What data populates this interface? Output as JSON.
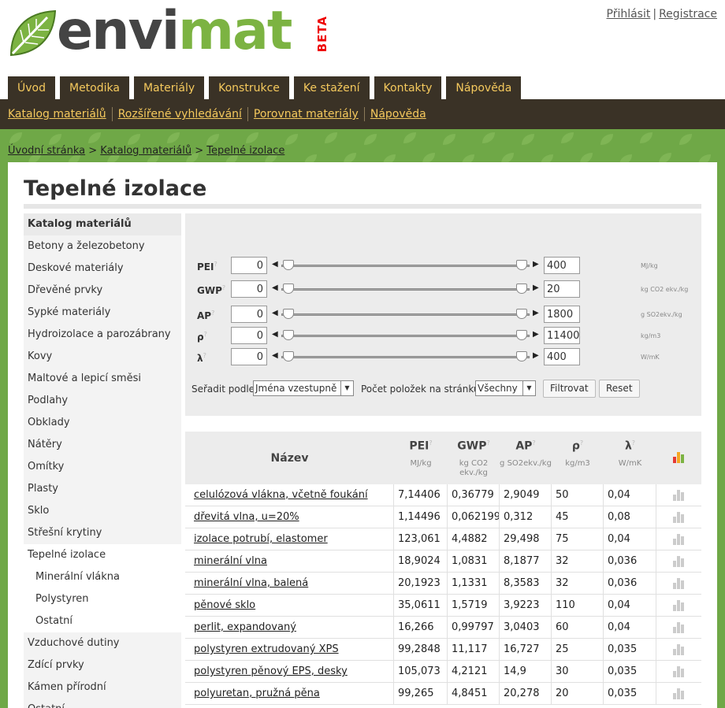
{
  "header": {
    "logo_text_a": "envi",
    "logo_text_b": "mat",
    "logo_badge": "BETA",
    "login": "Přihlásit",
    "separator": "|",
    "register": "Registrace"
  },
  "main_nav": [
    "Úvod",
    "Metodika",
    "Materiály",
    "Konstrukce",
    "Ke stažení",
    "Kontakty",
    "Nápověda"
  ],
  "sub_nav": [
    "Katalog materiálů",
    "Rozšířené vyhledávání",
    "Porovnat materiály",
    "Nápověda"
  ],
  "breadcrumb": {
    "home": "Úvodní stránka",
    "sep": ">",
    "catalog": "Katalog materiálů",
    "current": "Tepelné izolace"
  },
  "page_title": "Tepelné izolace",
  "sidebar": [
    {
      "label": "Katalog materiálů",
      "kind": "head"
    },
    {
      "label": "Betony a železobetony",
      "kind": "item"
    },
    {
      "label": "Deskové materiály",
      "kind": "item"
    },
    {
      "label": "Dřevěné prvky",
      "kind": "item"
    },
    {
      "label": "Sypké materiály",
      "kind": "item"
    },
    {
      "label": "Hydroizolace a parozábrany",
      "kind": "item"
    },
    {
      "label": "Kovy",
      "kind": "item"
    },
    {
      "label": "Maltové a lepicí směsi",
      "kind": "item"
    },
    {
      "label": "Podlahy",
      "kind": "item"
    },
    {
      "label": "Obklady",
      "kind": "item"
    },
    {
      "label": "Nátěry",
      "kind": "item"
    },
    {
      "label": "Omítky",
      "kind": "item"
    },
    {
      "label": "Plasty",
      "kind": "item"
    },
    {
      "label": "Sklo",
      "kind": "item"
    },
    {
      "label": "Střešní krytiny",
      "kind": "item"
    },
    {
      "label": "Tepelné izolace",
      "kind": "active"
    },
    {
      "label": "Minerální vlákna",
      "kind": "sub"
    },
    {
      "label": "Polystyren",
      "kind": "sub"
    },
    {
      "label": "Ostatní",
      "kind": "sub"
    },
    {
      "label": "Vzduchové dutiny",
      "kind": "item"
    },
    {
      "label": "Zdící prvky",
      "kind": "item"
    },
    {
      "label": "Kámen přírodní",
      "kind": "item"
    },
    {
      "label": "Ostatní",
      "kind": "item"
    }
  ],
  "filters": [
    {
      "label": "PEI",
      "sup": "?",
      "min": "0",
      "max": "400",
      "unit": "MJ/kg"
    },
    {
      "label": "GWP",
      "sup": "?",
      "min": "0",
      "max": "20",
      "unit": "kg CO2 ekv./kg"
    },
    {
      "label": "AP",
      "sup": "?",
      "min": "0",
      "max": "1800",
      "unit": "g SO2ekv./kg"
    },
    {
      "label": "ρ",
      "sup": "?",
      "min": "0",
      "max": "11400",
      "unit": "kg/m3"
    },
    {
      "label": "λ",
      "sup": "?",
      "min": "0",
      "max": "400",
      "unit": "W/mK"
    }
  ],
  "sort": {
    "label": "Seřadit podle:",
    "value": "Jména vzestupně",
    "per_page_label": "Počet položek na stránku:",
    "per_page_value": "Všechny",
    "filter_button": "Filtrovat",
    "reset_button": "Reset"
  },
  "table": {
    "headers": [
      {
        "name": "Název",
        "unit": ""
      },
      {
        "name": "PEI",
        "sup": "?",
        "unit": "MJ/kg"
      },
      {
        "name": "GWP",
        "sup": "?",
        "unit": "kg CO2 ekv./kg"
      },
      {
        "name": "AP",
        "sup": "?",
        "unit": "g SO2ekv./kg"
      },
      {
        "name": "ρ",
        "sup": "?",
        "unit": "kg/m3"
      },
      {
        "name": "λ",
        "sup": "?",
        "unit": "W/mK"
      }
    ],
    "rows": [
      [
        "celulózová vlákna, včetně foukání",
        "7,14406",
        "0,36779",
        "2,9049",
        "50",
        "0,04"
      ],
      [
        "dřevitá vlna, u=20%",
        "1,14496",
        "0,062199",
        "0,312",
        "45",
        "0,08"
      ],
      [
        "izolace potrubí, elastomer",
        "123,061",
        "4,4882",
        "29,498",
        "75",
        "0,04"
      ],
      [
        "minerální vlna",
        "18,9024",
        "1,0831",
        "8,1877",
        "32",
        "0,036"
      ],
      [
        "minerální vlna, balená",
        "20,1923",
        "1,1331",
        "8,3583",
        "32",
        "0,036"
      ],
      [
        "pěnové sklo",
        "35,0611",
        "1,5719",
        "3,9223",
        "110",
        "0,04"
      ],
      [
        "perlit, expandovaný",
        "16,266",
        "0,99797",
        "3,0403",
        "60",
        "0,04"
      ],
      [
        "polystyren extrudovaný XPS",
        "99,2848",
        "11,117",
        "16,727",
        "25",
        "0,035"
      ],
      [
        "polystyren pěnový EPS, desky",
        "105,073",
        "4,2121",
        "14,9",
        "30",
        "0,035"
      ],
      [
        "polyuretan, pružná pěna",
        "99,265",
        "4,8451",
        "20,278",
        "20",
        "0,035"
      ]
    ]
  },
  "colors": {
    "nav_bg": "#3a3226",
    "nav_text": "#f5c95d",
    "band_green": "#6fa847",
    "accent_icon": "#e53935"
  }
}
